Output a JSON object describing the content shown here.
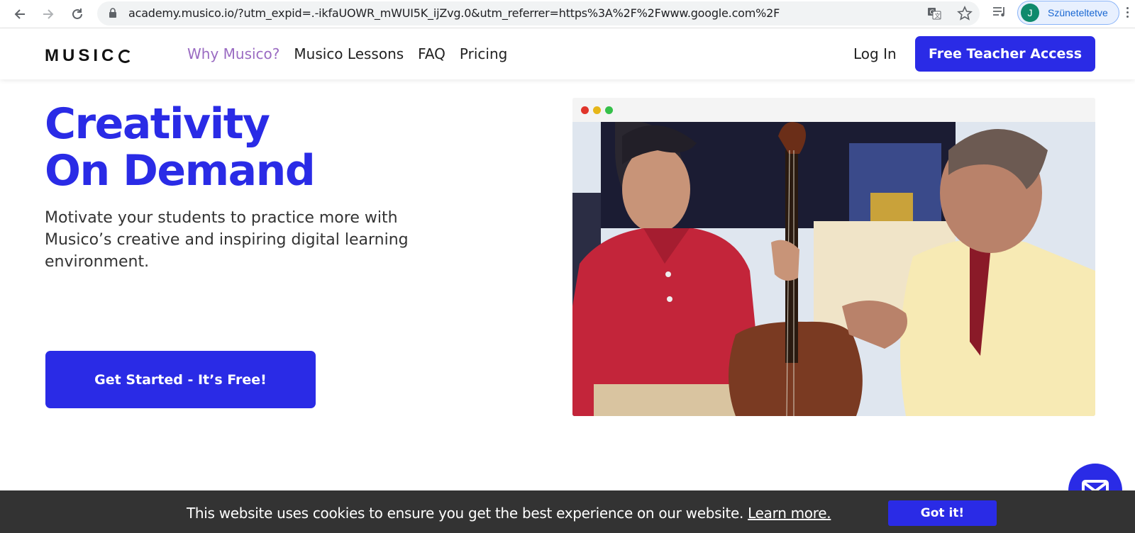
{
  "browser": {
    "url": "academy.musico.io/?utm_expid=.-ikfaUOWR_mWUI5K_ijZvg.0&utm_referrer=https%3A%2F%2Fwww.google.com%2F",
    "profile_initial": "J",
    "profile_name": "Szüneteltetve"
  },
  "header": {
    "logo": "MUSIC",
    "nav": [
      "Why Musico?",
      "Musico Lessons",
      "FAQ",
      "Pricing"
    ],
    "login": "Log In",
    "cta": "Free Teacher Access"
  },
  "hero": {
    "title_line1": "Creativity",
    "title_line2": "On Demand",
    "subtitle": "Motivate your students to practice more with Musico’s creative and inspiring digital learning environment.",
    "cta": "Get Started - It’s Free!"
  },
  "cookie": {
    "message": "This website uses cookies to ensure you get the best experience on our website.",
    "learn_more": "Learn more.",
    "button": "Got it!"
  },
  "colors": {
    "brand": "#2a2be6",
    "nav_active": "#9a6bc2",
    "cookie_bg": "#333333"
  },
  "icons": [
    "back-icon",
    "forward-icon",
    "reload-icon",
    "lock-icon",
    "translate-icon",
    "star-icon",
    "media-icon",
    "kebab-icon",
    "mail-icon"
  ]
}
